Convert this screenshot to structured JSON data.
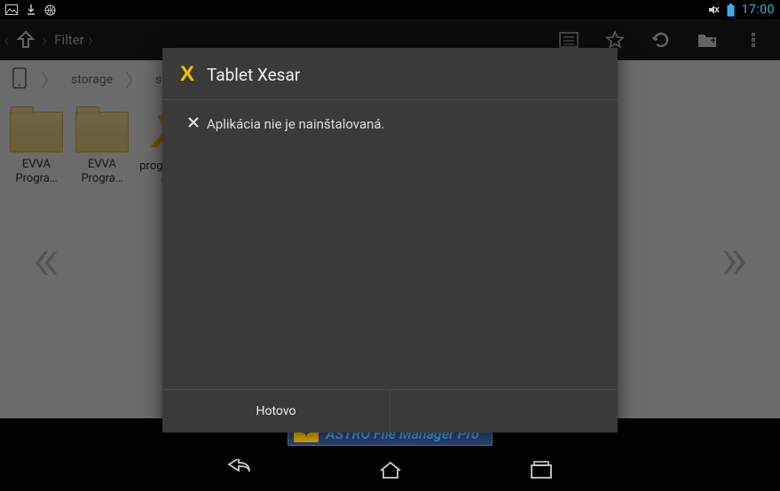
{
  "status_bar": {
    "time": "17:00"
  },
  "action_bar": {
    "filter_label": "Filter"
  },
  "breadcrumb": {
    "items": [
      "storage",
      "sdcard"
    ]
  },
  "files": [
    {
      "label": "EVVA Progra…",
      "type": "folder"
    },
    {
      "label": "EVVA Progra…",
      "type": "folder"
    },
    {
      "label": "programming",
      "type": "app"
    }
  ],
  "promo": {
    "text": "ASTRO File Manager Pro"
  },
  "dialog": {
    "icon_letter": "X",
    "title": "Tablet Xesar",
    "message": "Aplikácia nie je nainštalovaná.",
    "primary_button": "Hotovo",
    "secondary_button": ""
  }
}
